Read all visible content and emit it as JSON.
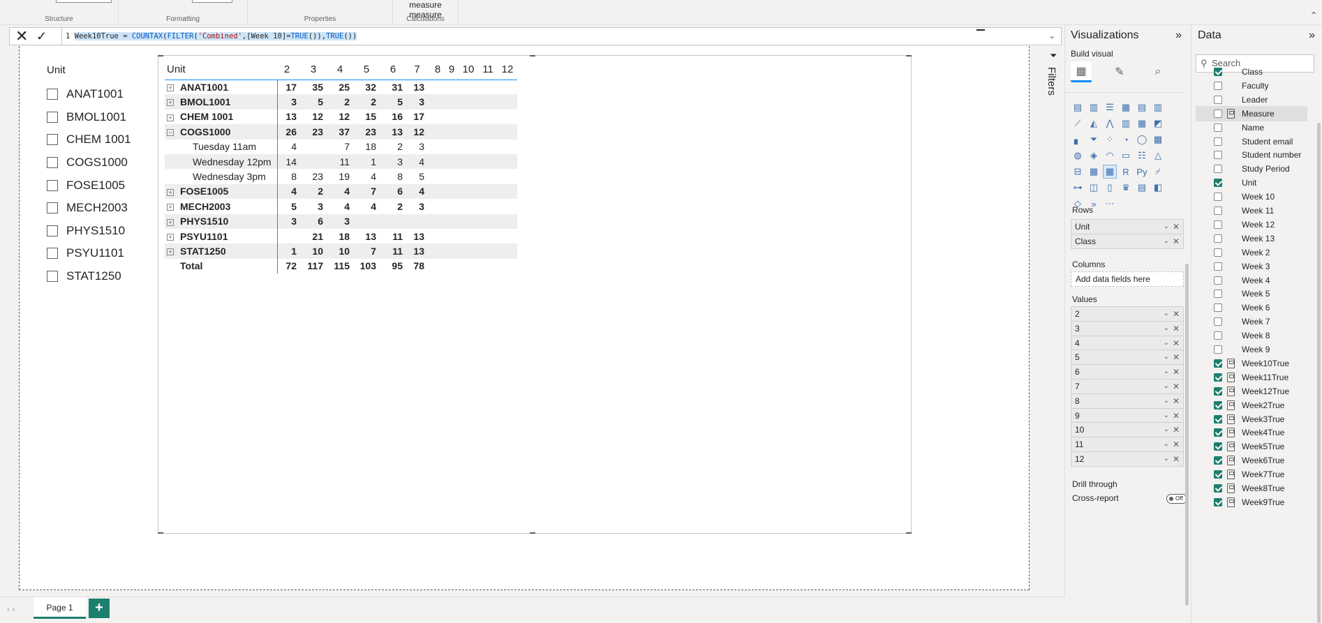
{
  "ribbon": {
    "groups": [
      {
        "label": "Structure",
        "top": ""
      },
      {
        "label": "Formatting",
        "top": ""
      },
      {
        "label": "Properties",
        "top": ""
      },
      {
        "label": "Calculations",
        "top": "measure measure"
      }
    ]
  },
  "formula": {
    "line_no": "1",
    "name": "Week10True",
    "eq": " = ",
    "fn1": "COUNTAX",
    "p1": "(",
    "fn2": "FILTER",
    "p2": "(",
    "tbl": "'Combined'",
    "rest": ",[Week 10]=",
    "fn3": "TRUE",
    "p3": "()),",
    "fn4": "TRUE",
    "p4": "())"
  },
  "slicer": {
    "title": "Unit",
    "items": [
      "ANAT1001",
      "BMOL1001",
      "CHEM 1001",
      "COGS1000",
      "FOSE1005",
      "MECH2003",
      "PHYS1510",
      "PSYU1101",
      "STAT1250"
    ]
  },
  "matrix": {
    "header": [
      "Unit",
      "2",
      "3",
      "4",
      "5",
      "6",
      "7",
      "8",
      "9",
      "10",
      "11",
      "12"
    ],
    "rows": [
      {
        "label": "ANAT1001",
        "type": "parent",
        "exp": "⊞",
        "v": [
          "17",
          "35",
          "25",
          "32",
          "31",
          "13",
          "",
          "",
          "",
          "",
          ""
        ]
      },
      {
        "label": "BMOL1001",
        "type": "parent",
        "exp": "⊞",
        "v": [
          "3",
          "5",
          "2",
          "2",
          "5",
          "3",
          "",
          "",
          "",
          "",
          ""
        ]
      },
      {
        "label": "CHEM 1001",
        "type": "parent",
        "exp": "⊞",
        "v": [
          "13",
          "12",
          "12",
          "15",
          "16",
          "17",
          "",
          "",
          "",
          "",
          ""
        ]
      },
      {
        "label": "COGS1000",
        "type": "parent",
        "exp": "⊟",
        "v": [
          "26",
          "23",
          "37",
          "23",
          "13",
          "12",
          "",
          "",
          "",
          "",
          ""
        ]
      },
      {
        "label": "Tuesday 11am",
        "type": "child",
        "exp": "",
        "v": [
          "4",
          "",
          "7",
          "18",
          "2",
          "3",
          "",
          "",
          "",
          "",
          ""
        ]
      },
      {
        "label": "Wednesday 12pm",
        "type": "child",
        "exp": "",
        "v": [
          "14",
          "",
          "11",
          "1",
          "3",
          "4",
          "",
          "",
          "",
          "",
          ""
        ]
      },
      {
        "label": "Wednesday 3pm",
        "type": "child",
        "exp": "",
        "v": [
          "8",
          "23",
          "19",
          "4",
          "8",
          "5",
          "",
          "",
          "",
          "",
          ""
        ]
      },
      {
        "label": "FOSE1005",
        "type": "parent",
        "exp": "⊞",
        "v": [
          "4",
          "2",
          "4",
          "7",
          "6",
          "4",
          "",
          "",
          "",
          "",
          ""
        ]
      },
      {
        "label": "MECH2003",
        "type": "parent",
        "exp": "⊞",
        "v": [
          "5",
          "3",
          "4",
          "4",
          "2",
          "3",
          "",
          "",
          "",
          "",
          ""
        ]
      },
      {
        "label": "PHYS1510",
        "type": "parent",
        "exp": "⊞",
        "v": [
          "3",
          "6",
          "3",
          "",
          "",
          "",
          "",
          "",
          "",
          "",
          ""
        ]
      },
      {
        "label": "PSYU1101",
        "type": "parent",
        "exp": "⊞",
        "v": [
          "",
          "21",
          "18",
          "13",
          "11",
          "13",
          "",
          "",
          "",
          "",
          ""
        ]
      },
      {
        "label": "STAT1250",
        "type": "parent",
        "exp": "⊞",
        "v": [
          "1",
          "10",
          "10",
          "7",
          "11",
          "13",
          "",
          "",
          "",
          "",
          ""
        ]
      },
      {
        "label": "Total",
        "type": "total",
        "exp": "",
        "v": [
          "72",
          "117",
          "115",
          "103",
          "95",
          "78",
          "",
          "",
          "",
          "",
          ""
        ]
      }
    ]
  },
  "filters": {
    "label": "Filters"
  },
  "viz": {
    "title": "Visualizations",
    "build": "Build visual",
    "rows_label": "Rows",
    "rows": [
      "Unit",
      "Class"
    ],
    "columns_label": "Columns",
    "columns_placeholder": "Add data fields here",
    "values_label": "Values",
    "values": [
      "2",
      "3",
      "4",
      "5",
      "6",
      "7",
      "8",
      "9",
      "10",
      "11",
      "12"
    ],
    "drill_label": "Drill through",
    "cross_report": "Cross-report",
    "toggle": "Off"
  },
  "data_pane": {
    "title": "Data",
    "search_placeholder": "Search",
    "fields": [
      {
        "name": "Class",
        "checked": true,
        "calc": false
      },
      {
        "name": "Faculty",
        "checked": false,
        "calc": false
      },
      {
        "name": "Leader",
        "checked": false,
        "calc": false
      },
      {
        "name": "Measure",
        "checked": false,
        "calc": true
      },
      {
        "name": "Name",
        "checked": false,
        "calc": false
      },
      {
        "name": "Student email",
        "checked": false,
        "calc": false
      },
      {
        "name": "Student number",
        "checked": false,
        "calc": false
      },
      {
        "name": "Study Period",
        "checked": false,
        "calc": false
      },
      {
        "name": "Unit",
        "checked": true,
        "calc": false
      },
      {
        "name": "Week 10",
        "checked": false,
        "calc": false
      },
      {
        "name": "Week 11",
        "checked": false,
        "calc": false
      },
      {
        "name": "Week 12",
        "checked": false,
        "calc": false
      },
      {
        "name": "Week 13",
        "checked": false,
        "calc": false
      },
      {
        "name": "Week 2",
        "checked": false,
        "calc": false
      },
      {
        "name": "Week 3",
        "checked": false,
        "calc": false
      },
      {
        "name": "Week 4",
        "checked": false,
        "calc": false
      },
      {
        "name": "Week 5",
        "checked": false,
        "calc": false
      },
      {
        "name": "Week 6",
        "checked": false,
        "calc": false
      },
      {
        "name": "Week 7",
        "checked": false,
        "calc": false
      },
      {
        "name": "Week 8",
        "checked": false,
        "calc": false
      },
      {
        "name": "Week 9",
        "checked": false,
        "calc": false
      },
      {
        "name": "Week10True",
        "checked": true,
        "calc": true
      },
      {
        "name": "Week11True",
        "checked": true,
        "calc": true
      },
      {
        "name": "Week12True",
        "checked": true,
        "calc": true
      },
      {
        "name": "Week2True",
        "checked": true,
        "calc": true
      },
      {
        "name": "Week3True",
        "checked": true,
        "calc": true
      },
      {
        "name": "Week4True",
        "checked": true,
        "calc": true
      },
      {
        "name": "Week5True",
        "checked": true,
        "calc": true
      },
      {
        "name": "Week6True",
        "checked": true,
        "calc": true
      },
      {
        "name": "Week7True",
        "checked": true,
        "calc": true
      },
      {
        "name": "Week8True",
        "checked": true,
        "calc": true
      },
      {
        "name": "Week9True",
        "checked": true,
        "calc": true
      }
    ]
  },
  "tabs": {
    "page": "Page 1",
    "add": "+"
  },
  "colors": {
    "accent": "#1b7f6e",
    "matrix_line": "#118dff",
    "function_blue": "#035aca"
  }
}
